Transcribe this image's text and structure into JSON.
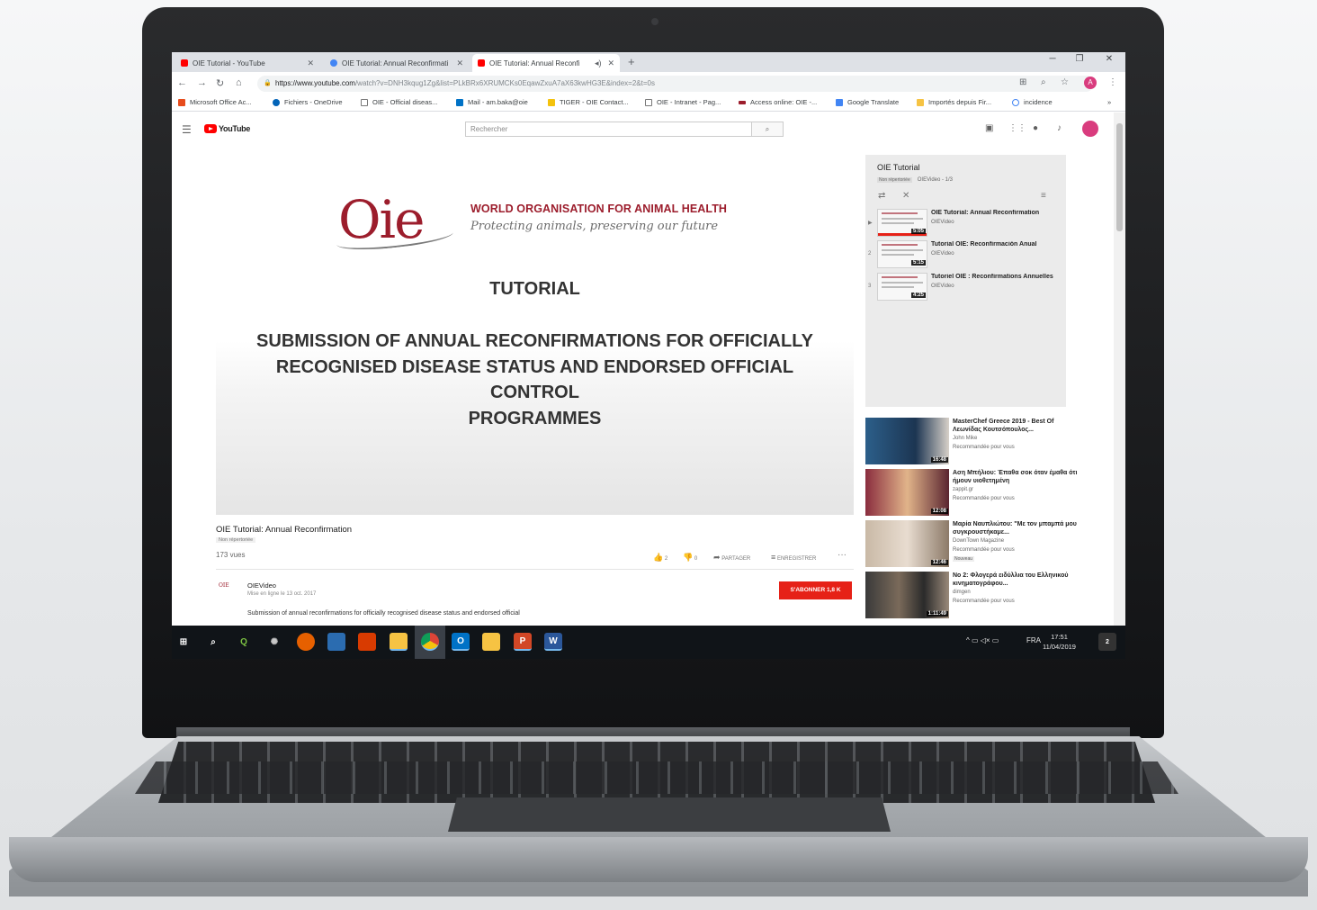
{
  "browser": {
    "tabs": [
      {
        "label": "OIE Tutorial - YouTube",
        "favicon": "youtube-icon"
      },
      {
        "label": "OIE Tutorial: Annual Reconfirmati",
        "favicon": "google-icon"
      },
      {
        "label": "OIE Tutorial: Annual Reconfi",
        "favicon": "youtube-icon",
        "active": true
      }
    ],
    "url_host": "https://www.youtube.com",
    "url_path": "/watch?v=DNH3kqug1Zg&list=PLkBRx6XRUMCKs0EqawZxuA7aX63kwHG3E&index=2&t=0s",
    "bookmarks": [
      "Microsoft Office Ac...",
      "Fichiers - OneDrive",
      "OIE - Official diseas...",
      "Mail - am.baka@oie",
      "TIGER - OIE Contact...",
      "OIE - Intranet - Pag...",
      "Access online: OIE -...",
      "Google Translate",
      "Importés depuis Fir...",
      "incidence"
    ],
    "more": "»",
    "profile_initial": "A"
  },
  "youtube": {
    "logo_text": "YouTube",
    "search_placeholder": "Rechercher"
  },
  "video": {
    "org_name": "WORLD ORGANISATION FOR ANIMAL HEALTH",
    "org_motto": "Protecting animals, preserving our future",
    "logo_text": "Oie",
    "slide_title": "TUTORIAL",
    "slide_line1": "SUBMISSION OF ANNUAL RECONFIRMATIONS FOR OFFICIALLY",
    "slide_line2": "RECOGNISED DISEASE STATUS AND ENDORSED OFFICIAL CONTROL",
    "slide_line3": "PROGRAMMES",
    "title": "OIE Tutorial: Annual Reconfirmation",
    "unlisted": "Non répertoriée",
    "views": "173 vues",
    "likes": "2",
    "dislikes": "0",
    "share": "PARTAGER",
    "save": "ENREGISTRER",
    "more": "···",
    "channel": "OIEVideo",
    "channel_logo": "OIE",
    "published": "Mise en ligne le 13 oct. 2017",
    "subscribe": "S'ABONNER  1,8 K",
    "description": "Submission of annual reconfirmations for officially recognised disease status and endorsed official"
  },
  "playlist": {
    "title": "OIE Tutorial",
    "meta_badge": "Non répertoriée",
    "meta": "OIEVideo - 1/3",
    "items": [
      {
        "index": "▶",
        "title": "OIE Tutorial: Annual Reconfirmation",
        "channel": "OIEVideo",
        "duration": "5:05"
      },
      {
        "index": "2",
        "title": "Tutorial OIE: Reconfirmación Anual",
        "channel": "OIEVideo",
        "duration": "5:15"
      },
      {
        "index": "3",
        "title": "Tutoriel OIE : Reconfirmations Annuelles",
        "channel": "OIEVideo",
        "duration": "4:25"
      }
    ]
  },
  "recommendations": [
    {
      "title": "MasterChef Greece 2019 - Best Of Λεωνίδας Κουτσόπουλος...",
      "channel": "John Mike",
      "reco": "Recommandée pour vous",
      "duration": "16:48",
      "badge": ""
    },
    {
      "title": "Αση Μπήλιου: Έπαθα σοκ όταν έμαθα ότι ήμουν υιοθετημένη",
      "channel": "zappit.gr",
      "reco": "Recommandée pour vous",
      "duration": "12:08",
      "badge": ""
    },
    {
      "title": "Μαρία Ναυπλιώτου: \"Με τον μπαμπά μου συγκρουστήκαμε...",
      "channel": "DownTown Magazine",
      "reco": "Recommandée pour vous",
      "duration": "12:46",
      "badge": "Nouveau"
    },
    {
      "title": "Νο 2: Φλογερά ειδύλλια του Ελληνικού κινηματογράφου...",
      "channel": "dimgen",
      "reco": "Recommandée pour vous",
      "duration": "1:11:49",
      "badge": ""
    }
  ],
  "taskbar": {
    "language": "FRA",
    "time": "17:51",
    "date": "11/04/2019",
    "notifications": "2"
  },
  "colors": {
    "oie_red": "#9c1d2c",
    "youtube_red": "#ff0000",
    "subscribe_red": "#e62117"
  }
}
